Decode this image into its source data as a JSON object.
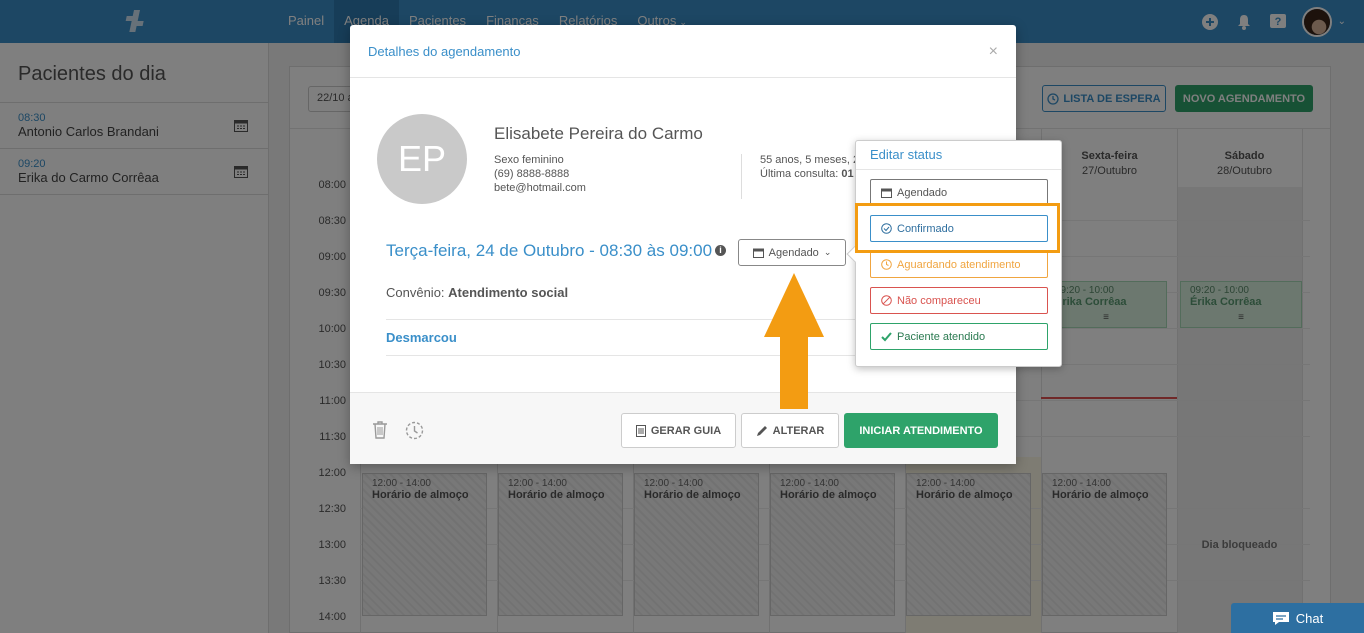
{
  "nav": {
    "items": [
      "Painel",
      "Agenda",
      "Pacientes",
      "Finanças",
      "Relatórios",
      "Outros"
    ],
    "active": "Agenda"
  },
  "sidebar": {
    "title": "Pacientes do dia",
    "patients": [
      {
        "time": "08:30",
        "name": "Antonio Carlos Brandani"
      },
      {
        "time": "09:20",
        "name": "Erika do Carmo Corrêaa"
      }
    ]
  },
  "calendar": {
    "date_input": "22/10 a",
    "waitlist_label": "LISTA DE ESPERA",
    "new_label": "NOVO AGENDAMENTO",
    "columns": [
      {
        "day": "Sexta-feira",
        "date": "27/Outubro"
      },
      {
        "day": "Sábado",
        "date": "28/Outubro"
      }
    ],
    "hours": [
      "08:00",
      "08:30",
      "09:00",
      "09:30",
      "10:00",
      "10:30",
      "11:00",
      "11:30",
      "12:00",
      "12:30",
      "13:00",
      "13:30",
      "14:00"
    ],
    "lunch": {
      "time": "12:00 - 14:00",
      "label": "Horário de almoço"
    },
    "appointments": [
      {
        "time": "09:20 - 10:00",
        "name": "Erika Corrêaa"
      },
      {
        "time": "09:20 - 10:00",
        "name": "Érika Corrêaa"
      }
    ],
    "blocked": "Dia bloqueado"
  },
  "modal": {
    "title": "Detalhes do agendamento",
    "close": "×",
    "initials": "EP",
    "patient_name": "Elisabete Pereira do Carmo",
    "sex": "Sexo feminino",
    "phone": "(69) 8888-8888",
    "email": "bete@hotmail.com",
    "age": "55 anos, 5 meses, 2",
    "last_visit_label": "Última consulta:",
    "last_visit_value": "01",
    "datetime": "Terça-feira, 24 de Outubro - 08:30 às 09:00",
    "status": "Agendado",
    "convenio_label": "Convênio:",
    "convenio_value": "Atendimento social",
    "desmarcou": "Desmarcou",
    "btn_guia": "GERAR GUIA",
    "btn_alterar": "ALTERAR",
    "btn_iniciar": "INICIAR ATENDIMENTO"
  },
  "status_popover": {
    "title": "Editar status",
    "options": [
      "Agendado",
      "Confirmado",
      "Aguardando atendimento",
      "Não compareceu",
      "Paciente atendido"
    ],
    "highlighted": "Confirmado"
  },
  "chat": {
    "label": "Chat"
  },
  "colors": {
    "primary": "#3a8fc9",
    "success": "#2ea36a",
    "warning": "#f0a540",
    "danger": "#d9534f",
    "annotation": "#f39c12"
  }
}
